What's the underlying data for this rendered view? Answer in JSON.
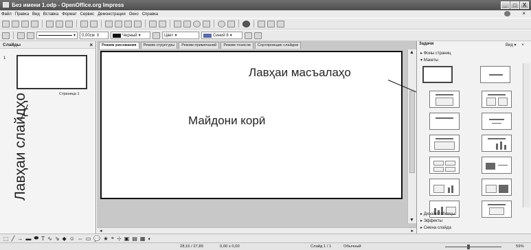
{
  "window": {
    "title": "Без имени 1.odp - OpenOffice.org Impress",
    "buttons": [
      "_",
      "□",
      "X"
    ]
  },
  "menu": {
    "items": [
      "Файл",
      "Правка",
      "Вид",
      "Вставка",
      "Формат",
      "Сервис",
      "Демонстрация",
      "Окно",
      "Справка"
    ],
    "close_doc": "×"
  },
  "toolbar2": {
    "line_width": "0,00см",
    "line_color": "Черный",
    "area_style": "Цвет",
    "area_color": "Синий 8"
  },
  "slides_pane": {
    "title": "Слайды",
    "close": "×",
    "slide_number": "1",
    "slide_caption": "Страница 1"
  },
  "view_tabs": [
    "Режим рисования",
    "Режим структуры",
    "Режим примечаний",
    "Режим тезисов",
    "Сортировщик слайдов"
  ],
  "annotations": {
    "slides_pane": "Лавҳаи слайдҳо",
    "layouts": "Лавҳаи масъалаҳо",
    "work_area": "Майдони корӣ"
  },
  "tasks_pane": {
    "title": "Задачи",
    "view_label": "Вид",
    "close": "×",
    "sections_top": [
      "Фоны страниц",
      "Макеты"
    ],
    "sections_bottom": [
      "Дизайн таблицы",
      "Эффекты",
      "Смена слайда"
    ]
  },
  "status": {
    "position": "28,16 / 27,89",
    "size": "0,00 x 0,00",
    "slide": "Слайд 1 / 1",
    "layout": "Обычный",
    "zoom": "59%"
  },
  "colors": {
    "titlebar": "#5a5a5a",
    "workspace": "#c8c8c8",
    "panel": "#f2f2f2"
  }
}
